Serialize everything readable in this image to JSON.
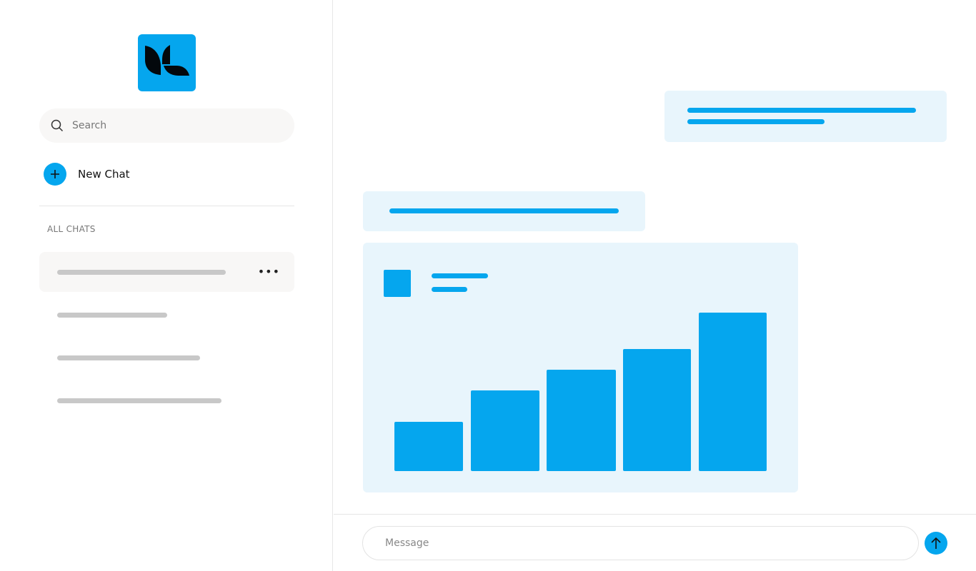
{
  "colors": {
    "accent": "#05a6ee",
    "bubble": "#e8f5fc",
    "placeholder_line": "#c8c8c8"
  },
  "sidebar": {
    "logo_icon": "leaf-logo-icon",
    "search": {
      "placeholder": "Search",
      "icon": "search-icon"
    },
    "new_chat": {
      "label": "New Chat",
      "icon": "plus-icon"
    },
    "section_title": "ALL CHATS",
    "chats": [
      {
        "active": true,
        "more_icon": "more-horizontal-icon"
      },
      {
        "active": false
      },
      {
        "active": false
      },
      {
        "active": false
      }
    ]
  },
  "main": {
    "chart_card": {
      "placeholder_bar_levels_percent": [
        31,
        51,
        64,
        77,
        100
      ]
    }
  },
  "composer": {
    "placeholder": "Message",
    "send_icon": "arrow-up-icon"
  }
}
